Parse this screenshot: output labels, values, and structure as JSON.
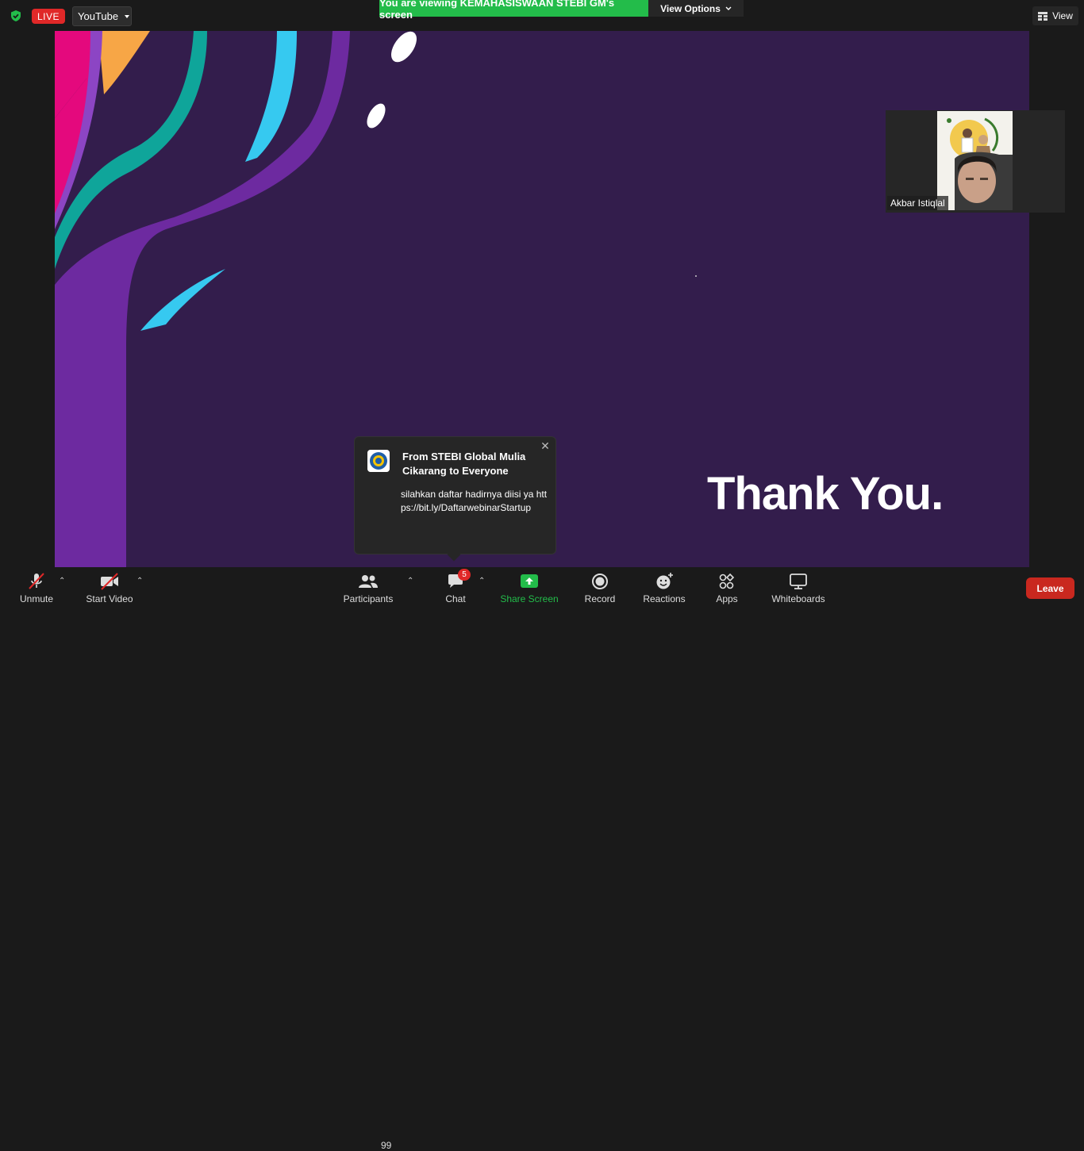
{
  "topbar": {
    "live_label": "LIVE",
    "stream_target": "YouTube",
    "viewing_banner": "You are viewing KEMAHASISWAAN STEBI GM's screen",
    "view_options": "View Options",
    "view_button": "View"
  },
  "slide": {
    "text": "Thank You."
  },
  "participant_video": {
    "name": "Akbar Istiqlal"
  },
  "chat_popup": {
    "from": "From STEBI Global Mulia Cikarang to Everyone",
    "message": "silahkan daftar hadirnya diisi ya https://bit.ly/DaftarwebinarStartup"
  },
  "toolbar": {
    "unmute": "Unmute",
    "start_video": "Start Video",
    "participants": "Participants",
    "participant_count": "99",
    "chat": "Chat",
    "chat_badge": "5",
    "share_screen": "Share Screen",
    "record": "Record",
    "reactions": "Reactions",
    "apps": "Apps",
    "whiteboards": "Whiteboards",
    "leave": "Leave"
  },
  "colors": {
    "share_green": "#23bc4a",
    "live_red": "#e02828",
    "leave_red": "#c9281f",
    "slide_bg": "#331d4c"
  }
}
